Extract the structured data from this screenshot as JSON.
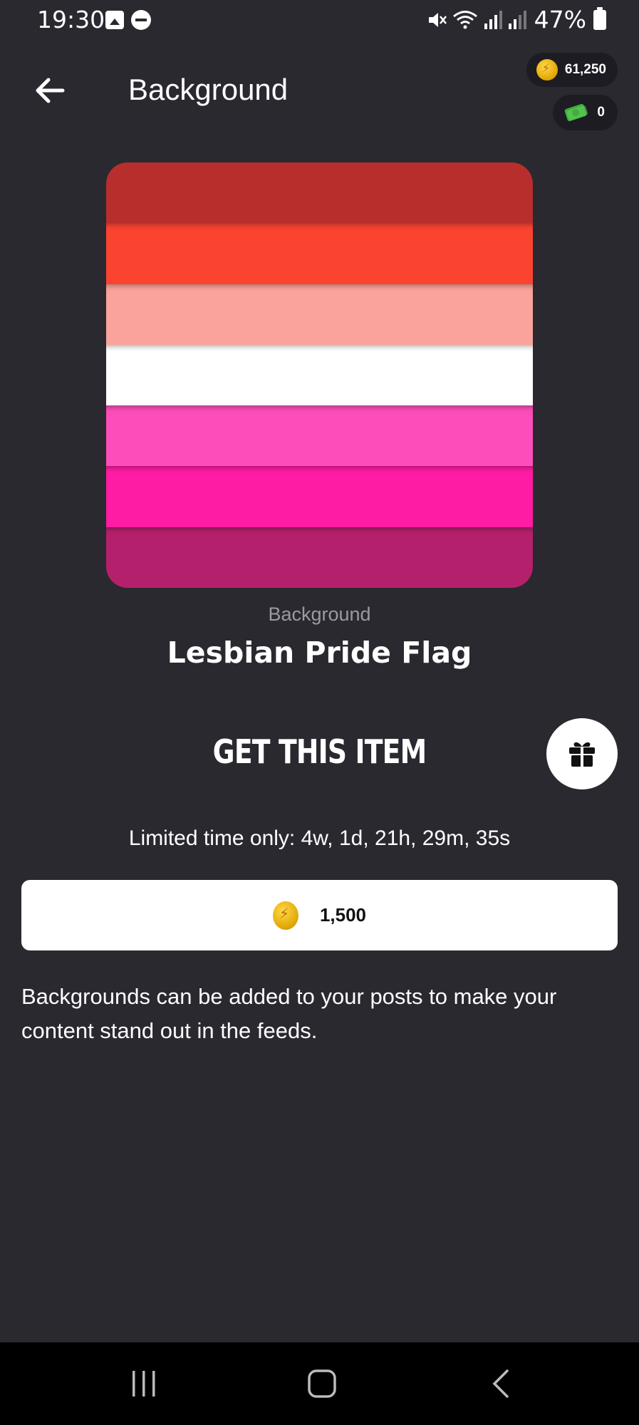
{
  "status_bar": {
    "time": "19:30",
    "battery_percent": "47%",
    "icons": [
      "gallery-icon",
      "do-not-disturb-icon",
      "mute-icon",
      "wifi-icon",
      "signal-icon",
      "signal-icon",
      "battery-icon"
    ]
  },
  "header": {
    "title": "Background",
    "back_icon": "arrow-left-icon"
  },
  "wallet": {
    "coins": "61,250",
    "cash": "0"
  },
  "item": {
    "category": "Background",
    "name": "Lesbian Pride Flag",
    "stripe_colors": [
      "#b82e2c",
      "#fb4430",
      "#faa39c",
      "#ffffff",
      "#fc4dba",
      "#fd1ca3",
      "#b5206d"
    ]
  },
  "purchase": {
    "heading": "GET THIS ITEM",
    "limited_time": "Limited time only: 4w, 1d, 21h, 29m, 35s",
    "price": "1,500",
    "gift_icon": "gift-icon"
  },
  "description": "Backgrounds can be added to your posts to make your content stand out in the feeds.",
  "nav": {
    "items": [
      "recents-icon",
      "home-icon",
      "back-icon"
    ]
  }
}
